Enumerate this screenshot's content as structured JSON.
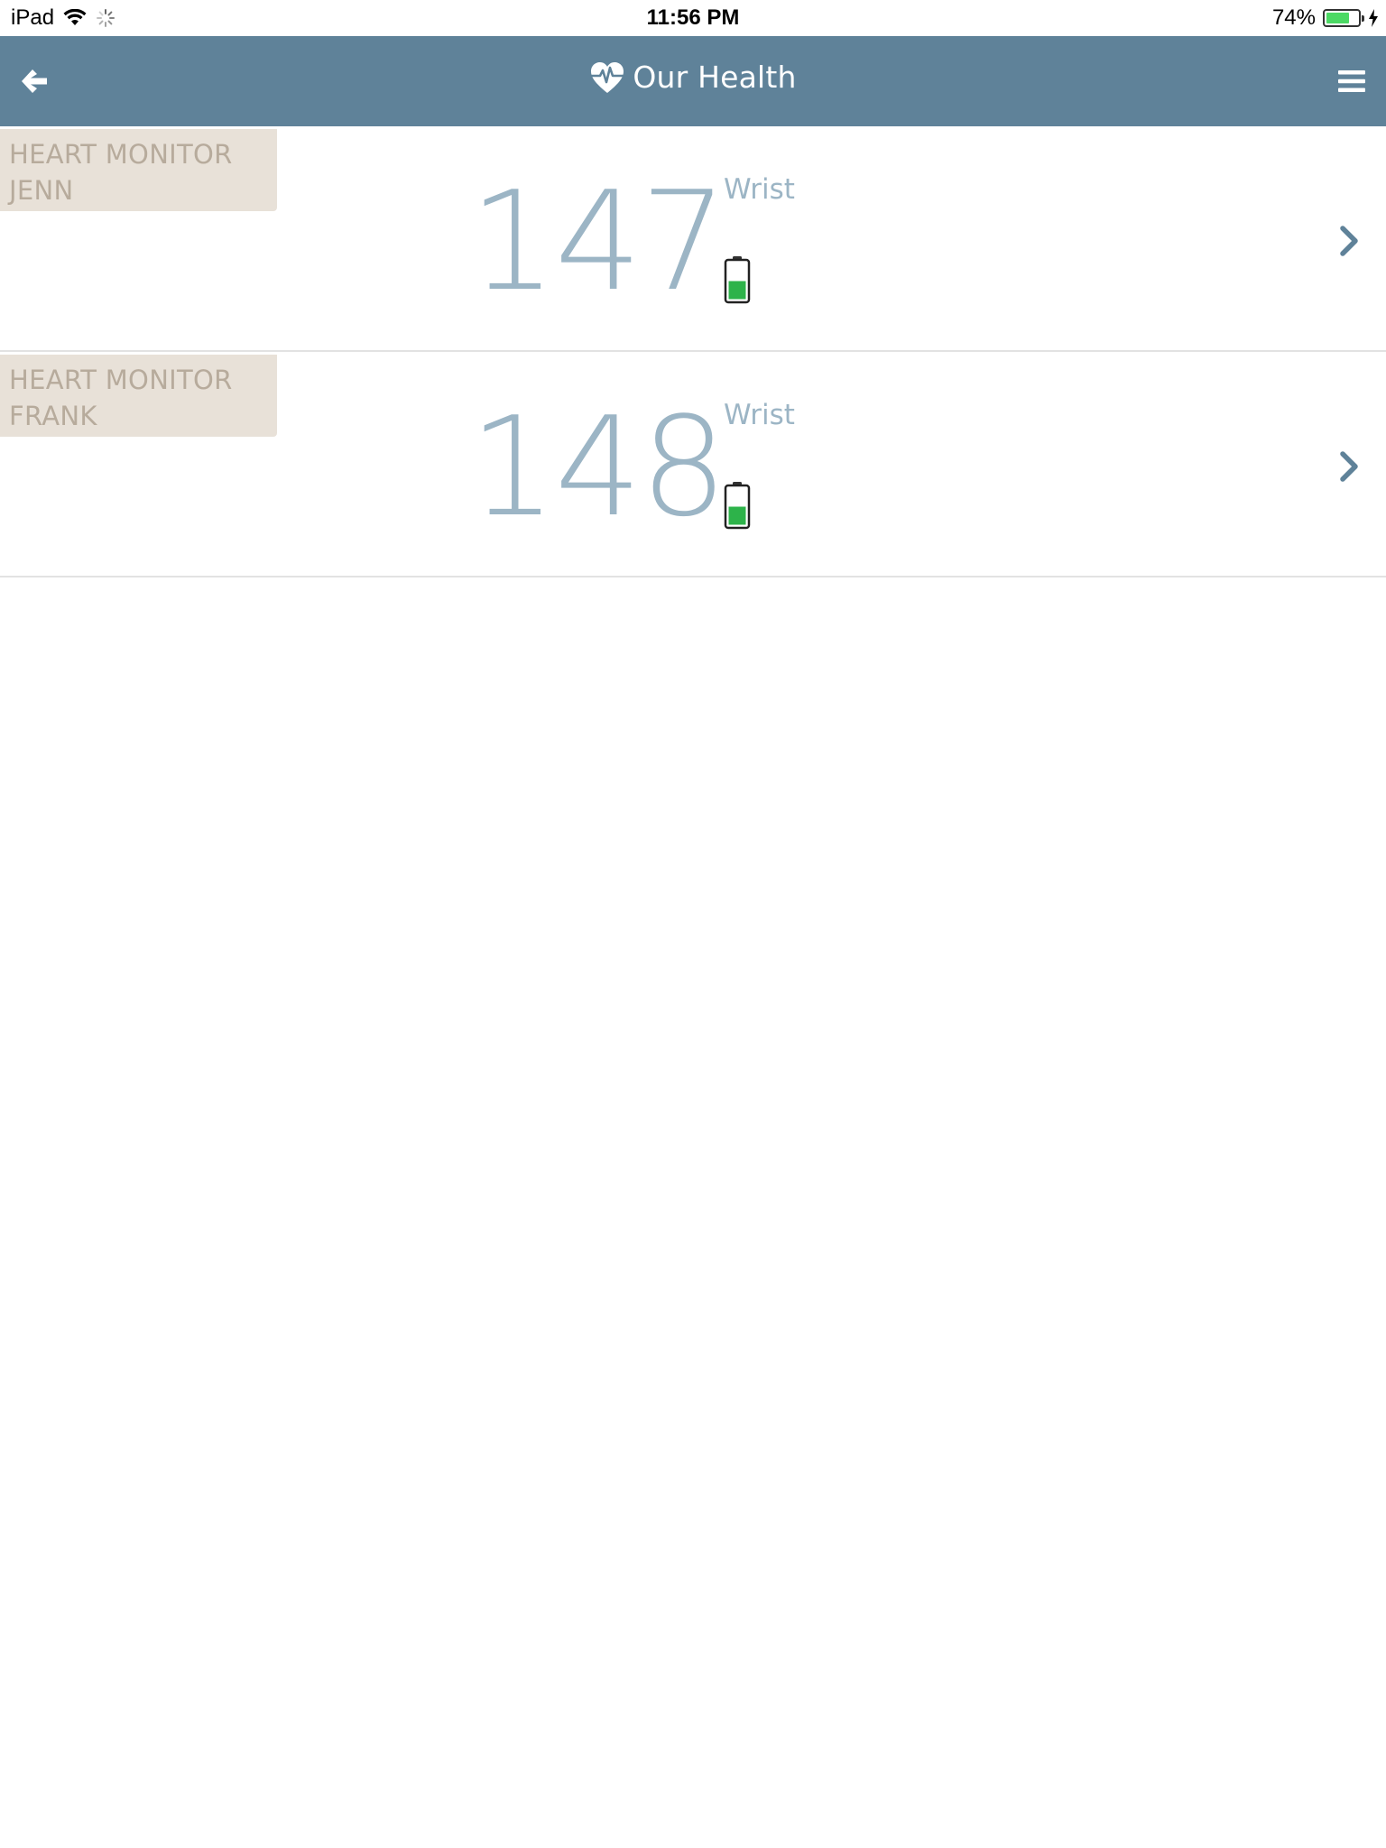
{
  "status_bar": {
    "device": "iPad",
    "time": "11:56 PM",
    "battery_percent": "74%",
    "battery_level": 0.74,
    "icons": [
      "wifi-icon",
      "activity-spinner-icon",
      "battery-icon",
      "charging-bolt-icon"
    ]
  },
  "header": {
    "title": "Our Health",
    "logo_icon": "heart-pulse-icon",
    "back_icon": "arrow-left-icon",
    "menu_icon": "hamburger-menu-icon",
    "background_color": "#5f8299"
  },
  "devices": [
    {
      "name_line1": "HEART MONITOR",
      "name_line2": "JENN",
      "reading": "147",
      "location": "Wrist",
      "battery_level": 0.5,
      "battery_color": "#2db34a"
    },
    {
      "name_line1": "HEART MONITOR",
      "name_line2": "FRANK",
      "reading": "148",
      "location": "Wrist",
      "battery_level": 0.5,
      "battery_color": "#2db34a"
    }
  ]
}
